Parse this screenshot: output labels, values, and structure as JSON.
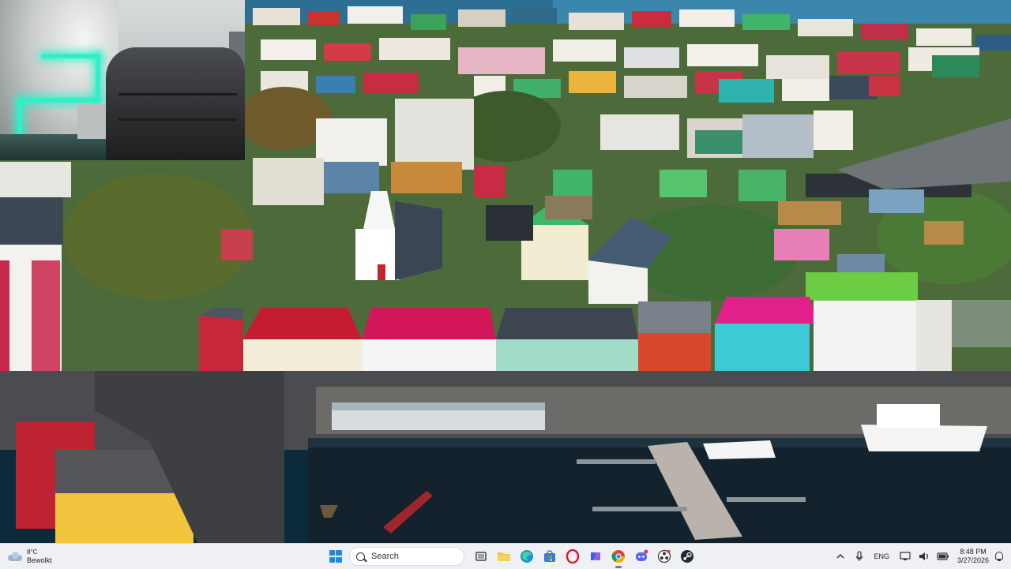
{
  "wallpaper": {
    "description_icon": "aerial-harbour-town"
  },
  "webcam": {
    "icon": "webcam-overlay"
  },
  "taskbar": {
    "weather": {
      "temperature": "8°C",
      "condition": "Bewolkt",
      "icon": "cloud-icon"
    },
    "search_placeholder": "Search",
    "apps": [
      {
        "name": "start",
        "icon": "windows-logo-icon"
      },
      {
        "name": "task-view",
        "icon": "task-view-icon"
      },
      {
        "name": "file-explorer",
        "icon": "folder-icon"
      },
      {
        "name": "edge",
        "icon": "edge-icon"
      },
      {
        "name": "store",
        "icon": "store-icon"
      },
      {
        "name": "opera",
        "icon": "opera-icon"
      },
      {
        "name": "copilot",
        "icon": "copilot-icon"
      },
      {
        "name": "chrome",
        "icon": "chrome-icon"
      },
      {
        "name": "discord",
        "icon": "discord-icon"
      },
      {
        "name": "obs",
        "icon": "obs-icon"
      },
      {
        "name": "steam",
        "icon": "steam-icon"
      }
    ],
    "tray": {
      "language": "ENG",
      "time": "8:48 PM",
      "date": "3/27/2026"
    },
    "colors": {
      "accent": "#1a8ae8",
      "taskbar_bg": "#eef0f3"
    }
  }
}
